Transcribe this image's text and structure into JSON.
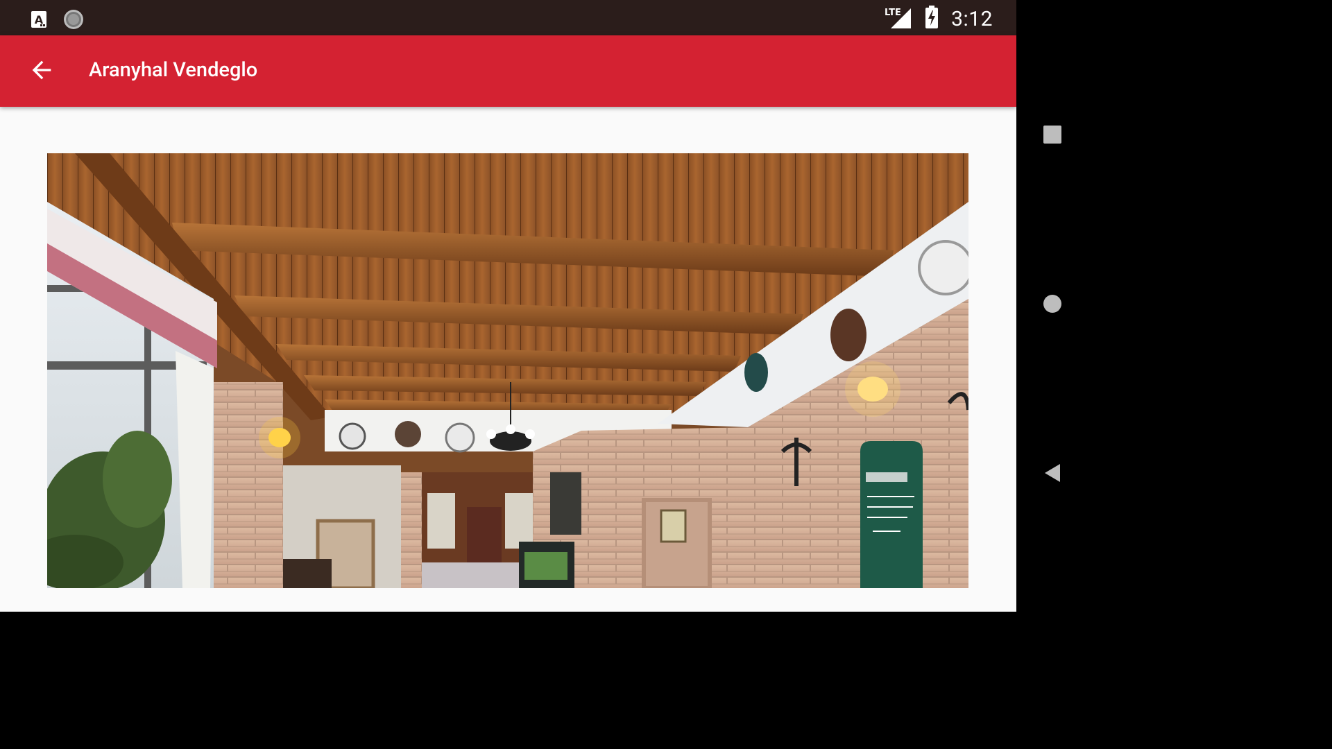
{
  "status_bar": {
    "time": "3:12",
    "network": "LTE",
    "icons": [
      "a-notification-icon",
      "sync-icon",
      "lte-signal-icon",
      "battery-charging-icon"
    ]
  },
  "app_bar": {
    "title": "Aranyhal Vendeglo",
    "back_icon": "arrow-back-icon",
    "color": "#d42232"
  },
  "content": {
    "image_subject": "restaurant interior"
  },
  "nav_bar": {
    "buttons": [
      "recents",
      "home",
      "back"
    ]
  }
}
